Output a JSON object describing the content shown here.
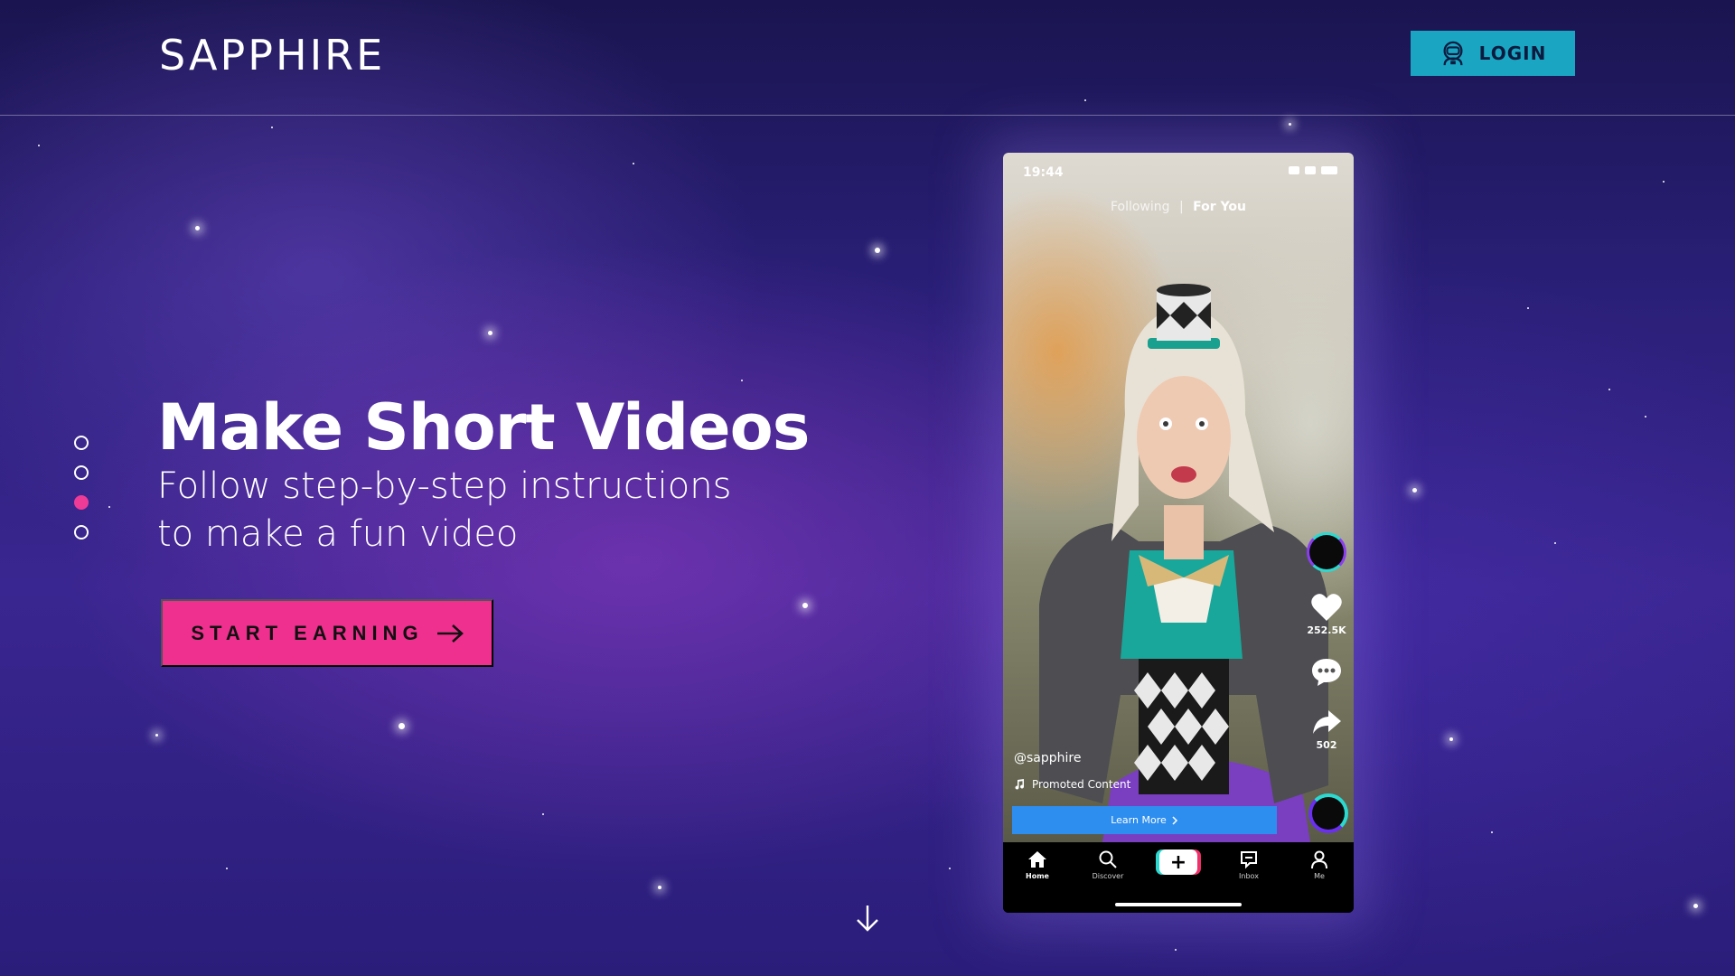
{
  "header": {
    "logo": "SAPPHIRE",
    "login_label": "LOGIN"
  },
  "pager": {
    "count": 4,
    "active_index": 2
  },
  "hero": {
    "title": "Make Short Videos",
    "subtitle_line1": "Follow step-by-step instructions",
    "subtitle_line2": "to make a fun video",
    "cta_label": "START EARNING"
  },
  "phone": {
    "time": "19:44",
    "feed_tabs": {
      "following": "Following",
      "separator": "|",
      "for_you": "For You"
    },
    "likes": "252.5K",
    "shares": "502",
    "username": "@sapphire",
    "promoted": "Promoted Content",
    "learn_more": "Learn More",
    "tabs": {
      "home": "Home",
      "discover": "Discover",
      "inbox": "Inbox",
      "me": "Me"
    },
    "create_symbol": "+"
  },
  "colors": {
    "accent_pink": "#f0308f",
    "accent_teal": "#1aa6c2",
    "background_purple": "#2a1f78"
  }
}
